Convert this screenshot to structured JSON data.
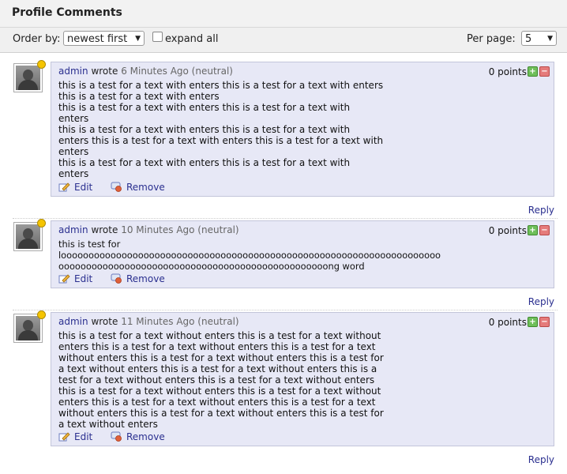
{
  "header": {
    "title": "Profile Comments"
  },
  "toolbar": {
    "order_label": "Order by:",
    "order_value": "newest first",
    "expand_label": "expand all",
    "per_page_label": "Per page:",
    "per_page_value": "5"
  },
  "comments": [
    {
      "author": "admin",
      "wrote": "wrote",
      "time": "6 Minutes Ago (neutral)",
      "points": "0 points",
      "text": "this is a test for a text with enters this is a test for a text with enters\nthis is a test for a text with enters\nthis is a test for a text with enters this is a test for a text with\nenters\nthis is a test for a text with enters this is a test for a text with\nenters this is a test for a text with enters this is a test for a text with\nenters\nthis is a test for a text with enters this is a test for a text with\nenters",
      "edit": "Edit",
      "remove": "Remove",
      "reply": "Reply"
    },
    {
      "author": "admin",
      "wrote": "wrote",
      "time": "10 Minutes Ago (neutral)",
      "points": "0 points",
      "text": "this is test for\nlooooooooooooooooooooooooooooooooooooooooooooooooooooooooooooooooooooo\nooooooooooooooooooooooooooooooooooooooooooooooooong word",
      "edit": "Edit",
      "remove": "Remove",
      "reply": "Reply"
    },
    {
      "author": "admin",
      "wrote": "wrote",
      "time": "11 Minutes Ago (neutral)",
      "points": "0 points",
      "text": "this is a test for a text without enters this is a test for a text without\nenters this is a test for a text without enters this is a test for a text\nwithout enters this is a test for a text without enters this is a test for\na text without enters this is a test for a text without enters this is a\ntest for a text without enters this is a test for a text without enters\nthis is a test for a text without enters this is a test for a text without\nenters this is a test for a text without enters this is a test for a text\nwithout enters this is a test for a text without enters this is a test for\na text without enters",
      "edit": "Edit",
      "remove": "Remove",
      "reply": "Reply"
    }
  ],
  "colors": {
    "bubble_bg": "#e7e8f6",
    "link": "#2a2f8f",
    "status_dot": "#f5c400",
    "vote_up": "#6fbf5a",
    "vote_down": "#e57b7b"
  }
}
